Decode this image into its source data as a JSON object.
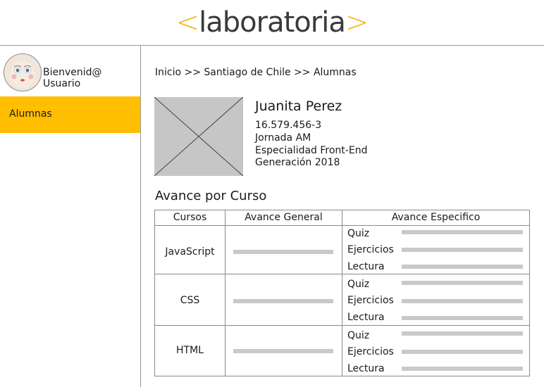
{
  "header": {
    "logo_open": "<",
    "logo_name": "laboratoria",
    "logo_close": ">"
  },
  "sidebar": {
    "welcome": "Bienvenid@ Usuario",
    "nav": [
      {
        "label": "Alumnas"
      }
    ]
  },
  "breadcrumb": "Inicio >> Santiago de Chile >> Alumnas",
  "student": {
    "name": "Juanita Perez",
    "rut": "16.579.456-3",
    "jornada": "Jornada AM",
    "especialidad": "Especialidad Front-End",
    "generacion": "Generación 2018"
  },
  "progress": {
    "title": "Avance por Curso",
    "headers": [
      "Cursos",
      "Avance General",
      "Avance Especifico"
    ],
    "courses": [
      {
        "name": "JavaScript",
        "items": [
          "Quiz",
          "Ejercicios",
          "Lectura"
        ]
      },
      {
        "name": "CSS",
        "items": [
          "Quiz",
          "Ejercicios",
          "Lectura"
        ]
      },
      {
        "name": "HTML",
        "items": [
          "Quiz",
          "Ejercicios",
          "Lectura"
        ]
      }
    ]
  },
  "colors": {
    "accent": "#ffbe00",
    "logo_bracket": "#f6b512",
    "placeholder": "#c6c6c6"
  }
}
